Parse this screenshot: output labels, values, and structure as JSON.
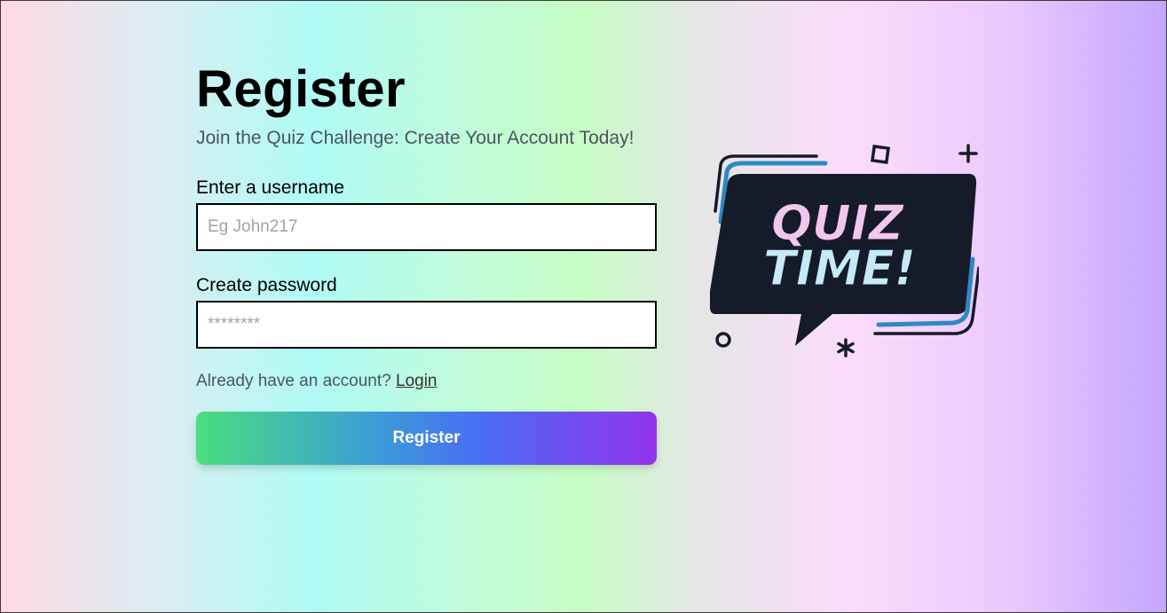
{
  "register": {
    "title": "Register",
    "subtitle": "Join the Quiz Challenge: Create Your Account Today!",
    "username": {
      "label": "Enter a username",
      "placeholder": "Eg John217",
      "value": ""
    },
    "password": {
      "label": "Create password",
      "placeholder": "********",
      "value": ""
    },
    "login_prompt": "Already have an account?",
    "login_link": "Login",
    "submit_label": "Register"
  },
  "logo": {
    "line1": "QUIZ",
    "line2": "TIME!",
    "icon": "quiz-time-speech-bubble"
  },
  "colors": {
    "button_gradient": [
      "#4ade80",
      "#3b9bd8",
      "#4a6cf5",
      "#9333ea"
    ],
    "logo_bubble": "#161b29",
    "logo_accent_blue": "#2b8ac4",
    "logo_accent_pink": "#e6b8ee"
  }
}
